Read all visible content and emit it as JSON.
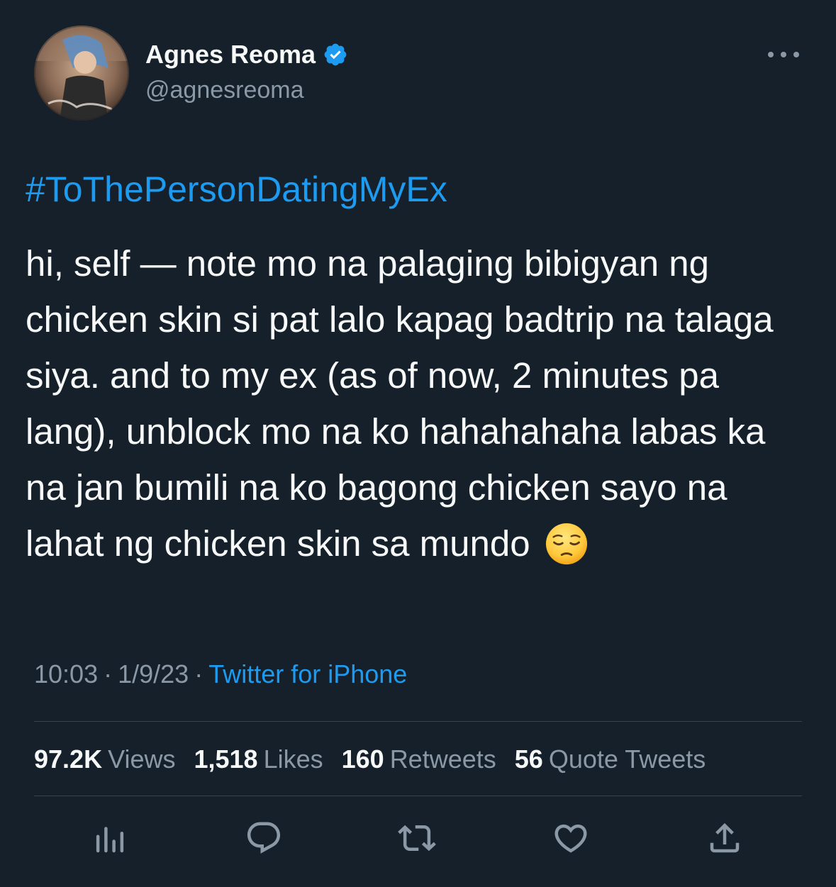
{
  "author": {
    "name": "Agnes Reoma",
    "handle": "@agnesreoma",
    "avatar_icon": "profile-photo",
    "verified_icon": "verified-badge-icon"
  },
  "tweet": {
    "hashtag": "#ToThePersonDatingMyEx",
    "text": "hi, self — note mo na palaging bibigyan ng chicken skin si pat lalo kapag badtrip na talaga siya. and to my ex (as of now, 2 minutes pa lang), unblock mo na ko hahahahaha labas ka na jan bumili na ko bagong chicken sayo na lahat ng chicken skin sa mundo",
    "emoji": "pensive-face",
    "time": "10:03",
    "date": "1/9/23",
    "separator": "·",
    "source": "Twitter for iPhone"
  },
  "stats": {
    "views": {
      "count": "97.2K",
      "label": "Views"
    },
    "likes": {
      "count": "1,518",
      "label": "Likes"
    },
    "retweets": {
      "count": "160",
      "label": "Retweets"
    },
    "quotes": {
      "count": "56",
      "label": "Quote Tweets"
    }
  },
  "colors": {
    "background": "#15202b",
    "accent": "#1d9bf0",
    "secondary_text": "#8b98a5",
    "divider": "#38444d"
  }
}
